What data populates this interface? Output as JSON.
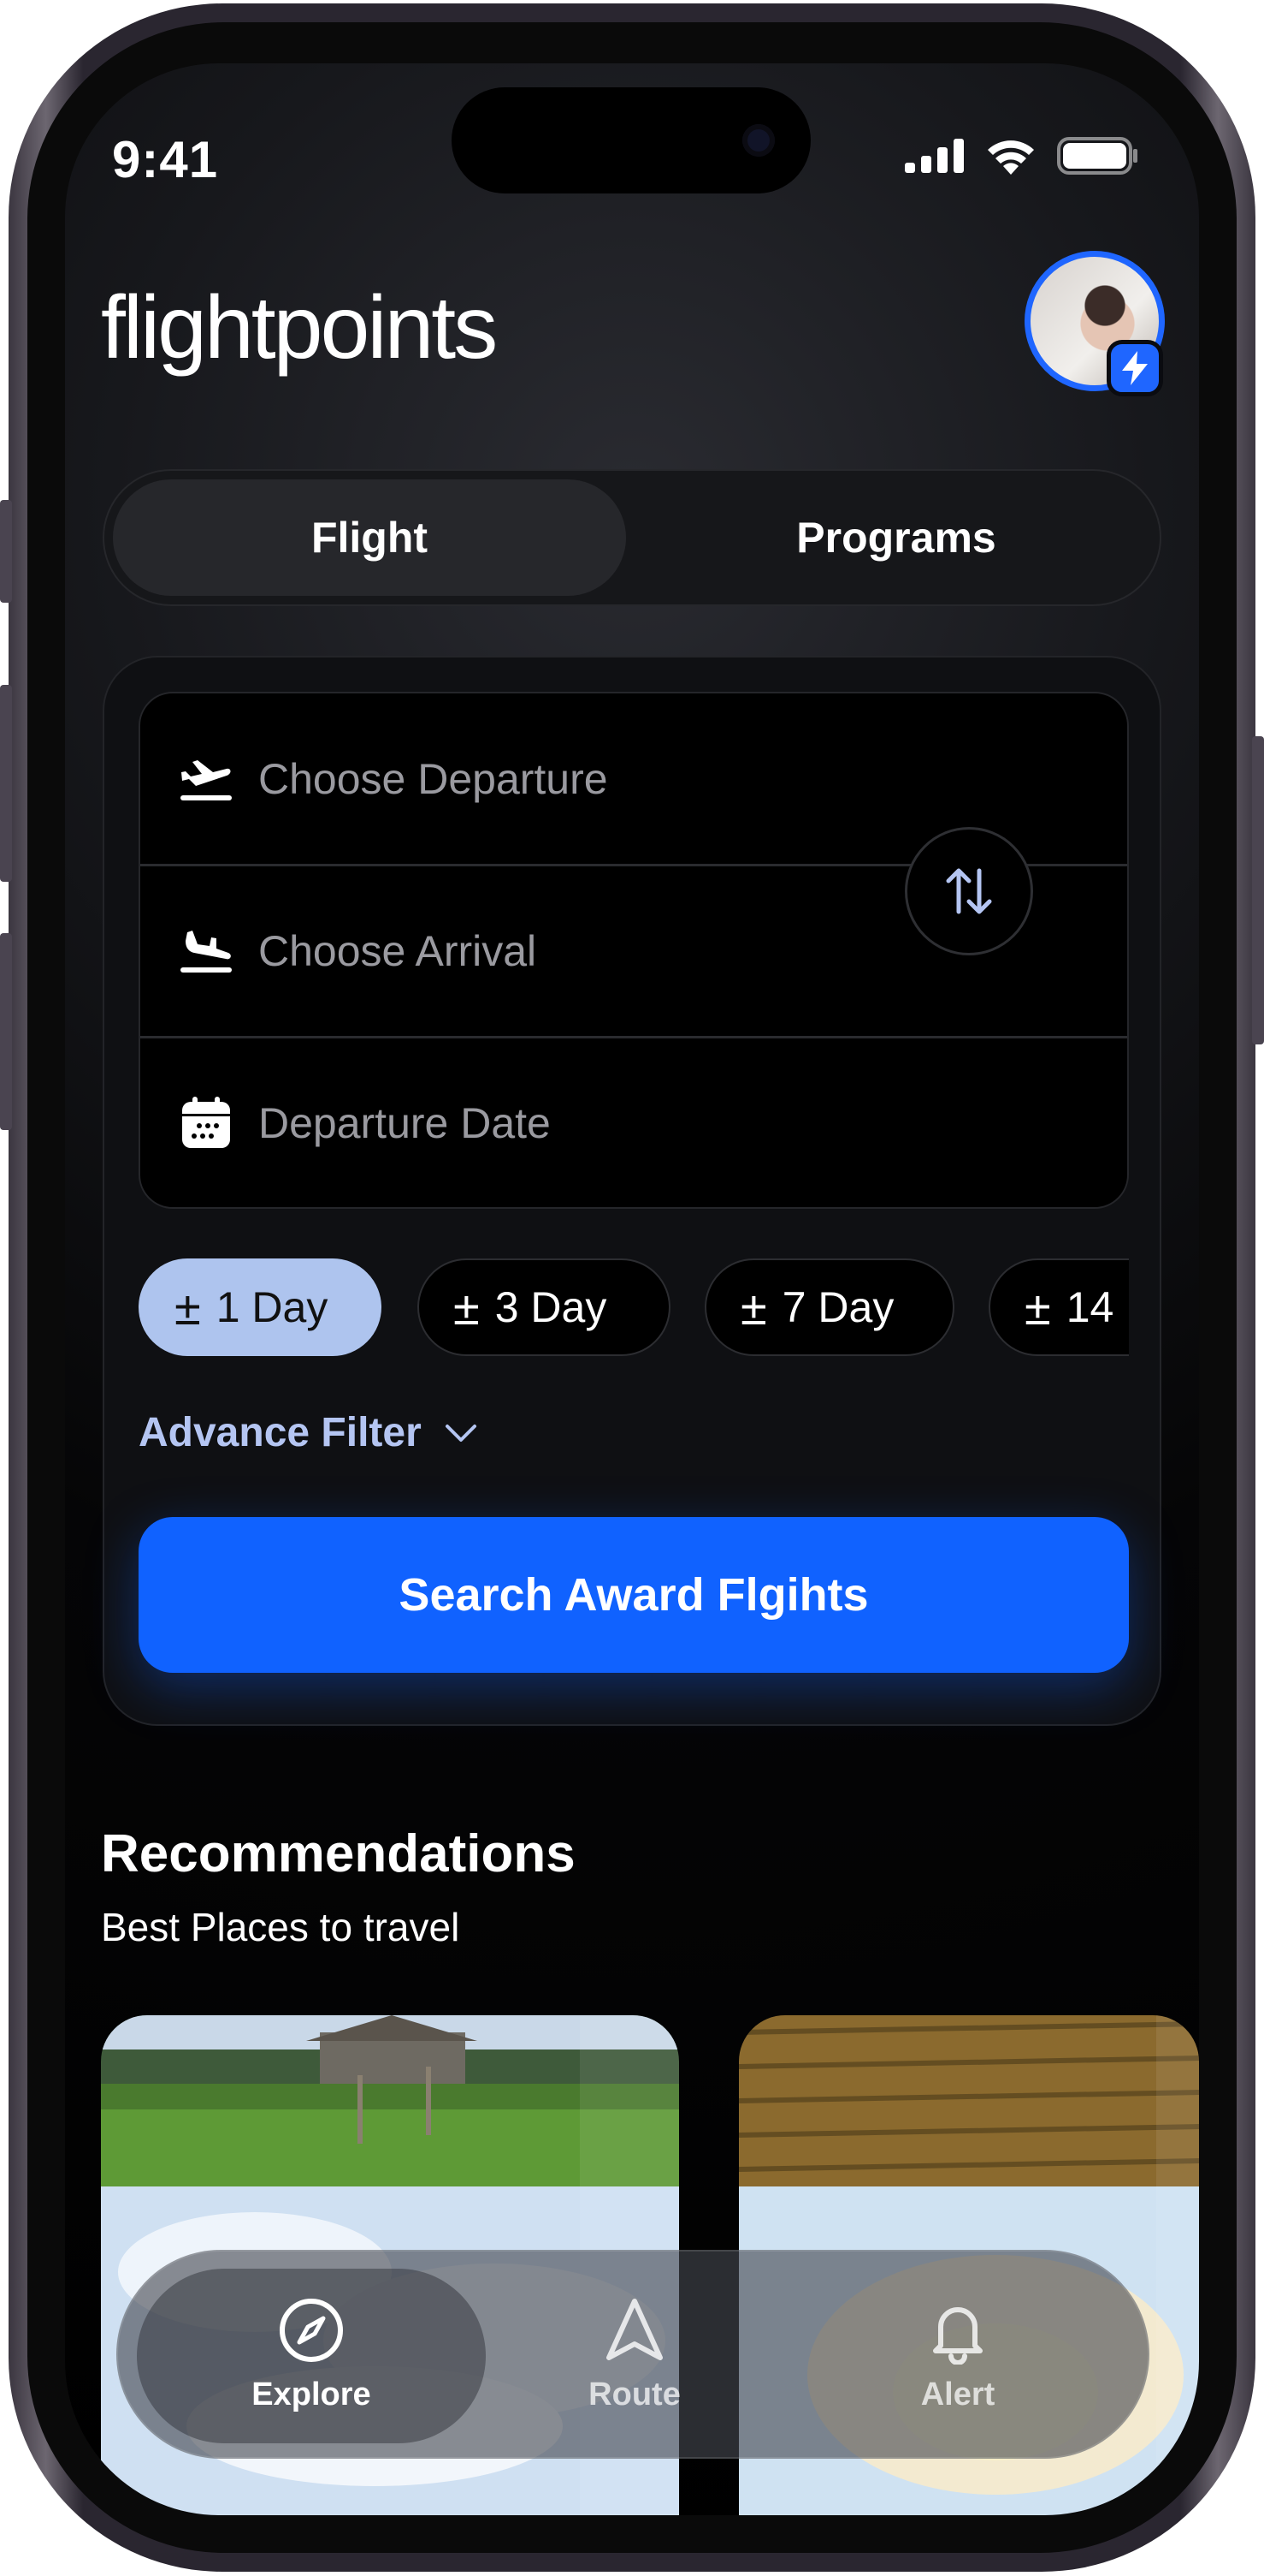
{
  "status": {
    "time": "9:41"
  },
  "app": {
    "logo": "flightpoints"
  },
  "segments": {
    "flight": "Flight",
    "programs": "Programs"
  },
  "search_form": {
    "departure_placeholder": "Choose Departure",
    "arrival_placeholder": "Choose Arrival",
    "date_placeholder": "Departure Date",
    "chips": [
      {
        "label": "1 Day",
        "selected": true
      },
      {
        "label": "3 Day",
        "selected": false
      },
      {
        "label": "7 Day",
        "selected": false
      },
      {
        "label": "14",
        "selected": false
      }
    ],
    "advance_filter": "Advance Filter",
    "search_button": "Search Award Flgihts"
  },
  "recommendations": {
    "title": "Recommendations",
    "subtitle": "Best Places to travel"
  },
  "tabbar": {
    "items": [
      {
        "label": "Explore",
        "icon": "compass-icon",
        "active": true
      },
      {
        "label": "Route",
        "icon": "navigation-arrow-icon",
        "active": false
      },
      {
        "label": "Alert",
        "icon": "bell-icon",
        "active": false
      }
    ]
  },
  "colors": {
    "accent": "#1062ff",
    "chip_active": "#aec4ee",
    "filter_text": "#b4c5f2"
  }
}
